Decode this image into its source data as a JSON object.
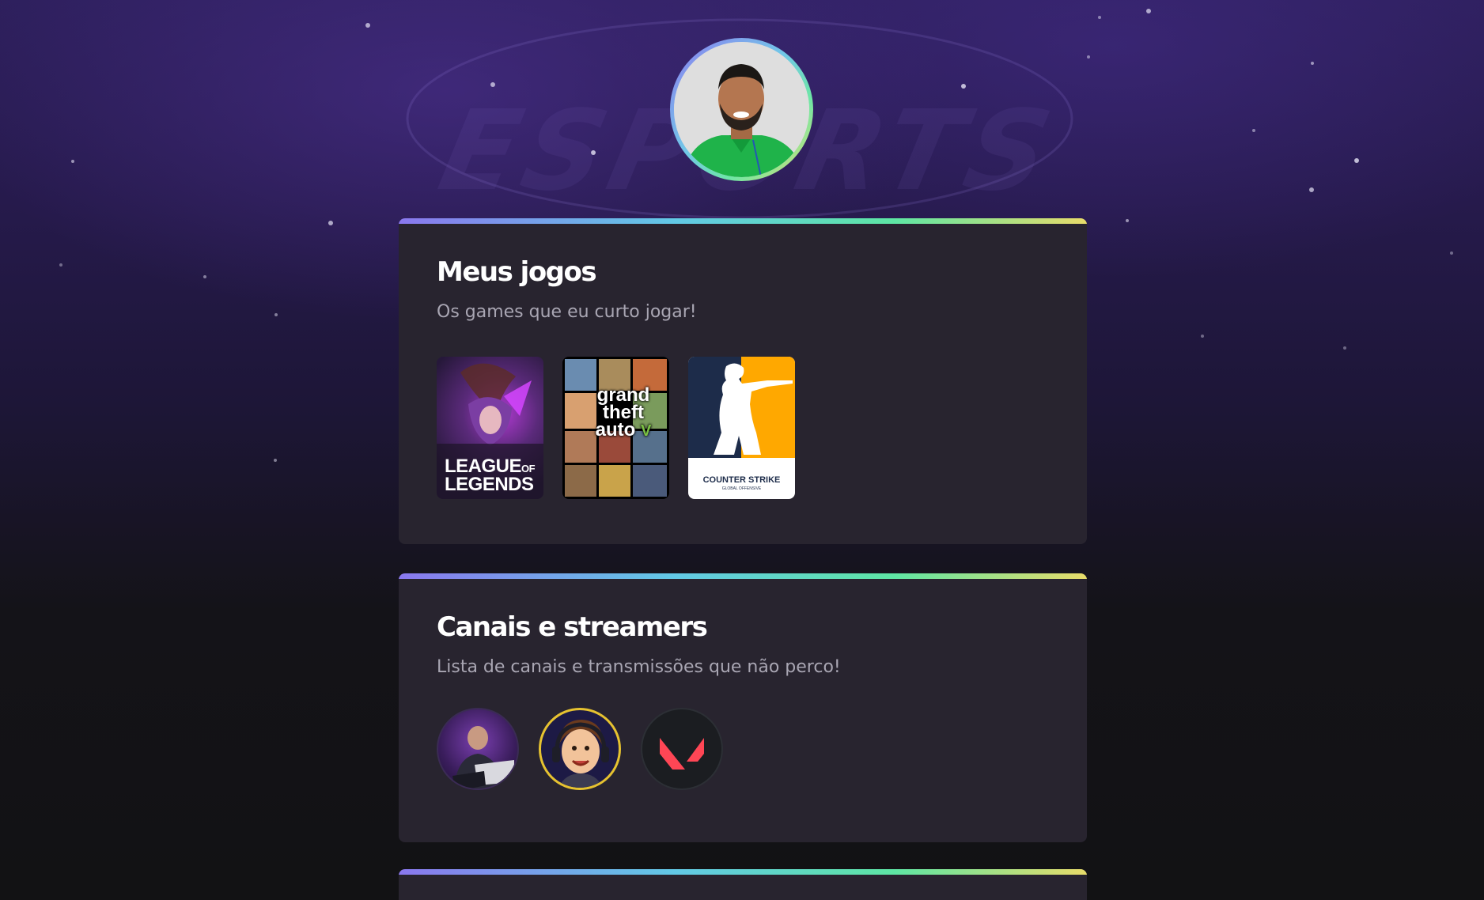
{
  "profile": {
    "avatar_icon": "profile-photo"
  },
  "background": {
    "watermark_text": "ESPORTS"
  },
  "games_section": {
    "title": "Meus jogos",
    "subtitle": "Os games que eu curto jogar!",
    "games": [
      {
        "name": "League of Legends",
        "line1": "LEAGUE",
        "line1b": "OF",
        "line2": "LEGENDS"
      },
      {
        "name": "Grand Theft Auto V",
        "line1": "grand",
        "line2": "theft",
        "line3": "auto",
        "line4": "V"
      },
      {
        "name": "Counter Strike",
        "brand_left": "COUNTER",
        "brand_right": "STRIKE",
        "tagline": "GLOBAL OFFENSIVE"
      }
    ]
  },
  "streamers_section": {
    "title": "Canais e streamers",
    "subtitle": "Lista de canais e transmissões que não perco!",
    "channels": [
      {
        "icon": "streamer-at-laptop"
      },
      {
        "icon": "cartoon-streamer-headset"
      },
      {
        "icon": "valorant-logo"
      }
    ]
  },
  "colors": {
    "card_bg": "#28242f",
    "gradient_start": "#8a78ee",
    "gradient_mid": "#5ee6a4",
    "gradient_end": "#e8dc6a",
    "cs_orange": "#ffa800",
    "cs_navy": "#1d2c4a",
    "valorant_red": "#ff4655"
  }
}
